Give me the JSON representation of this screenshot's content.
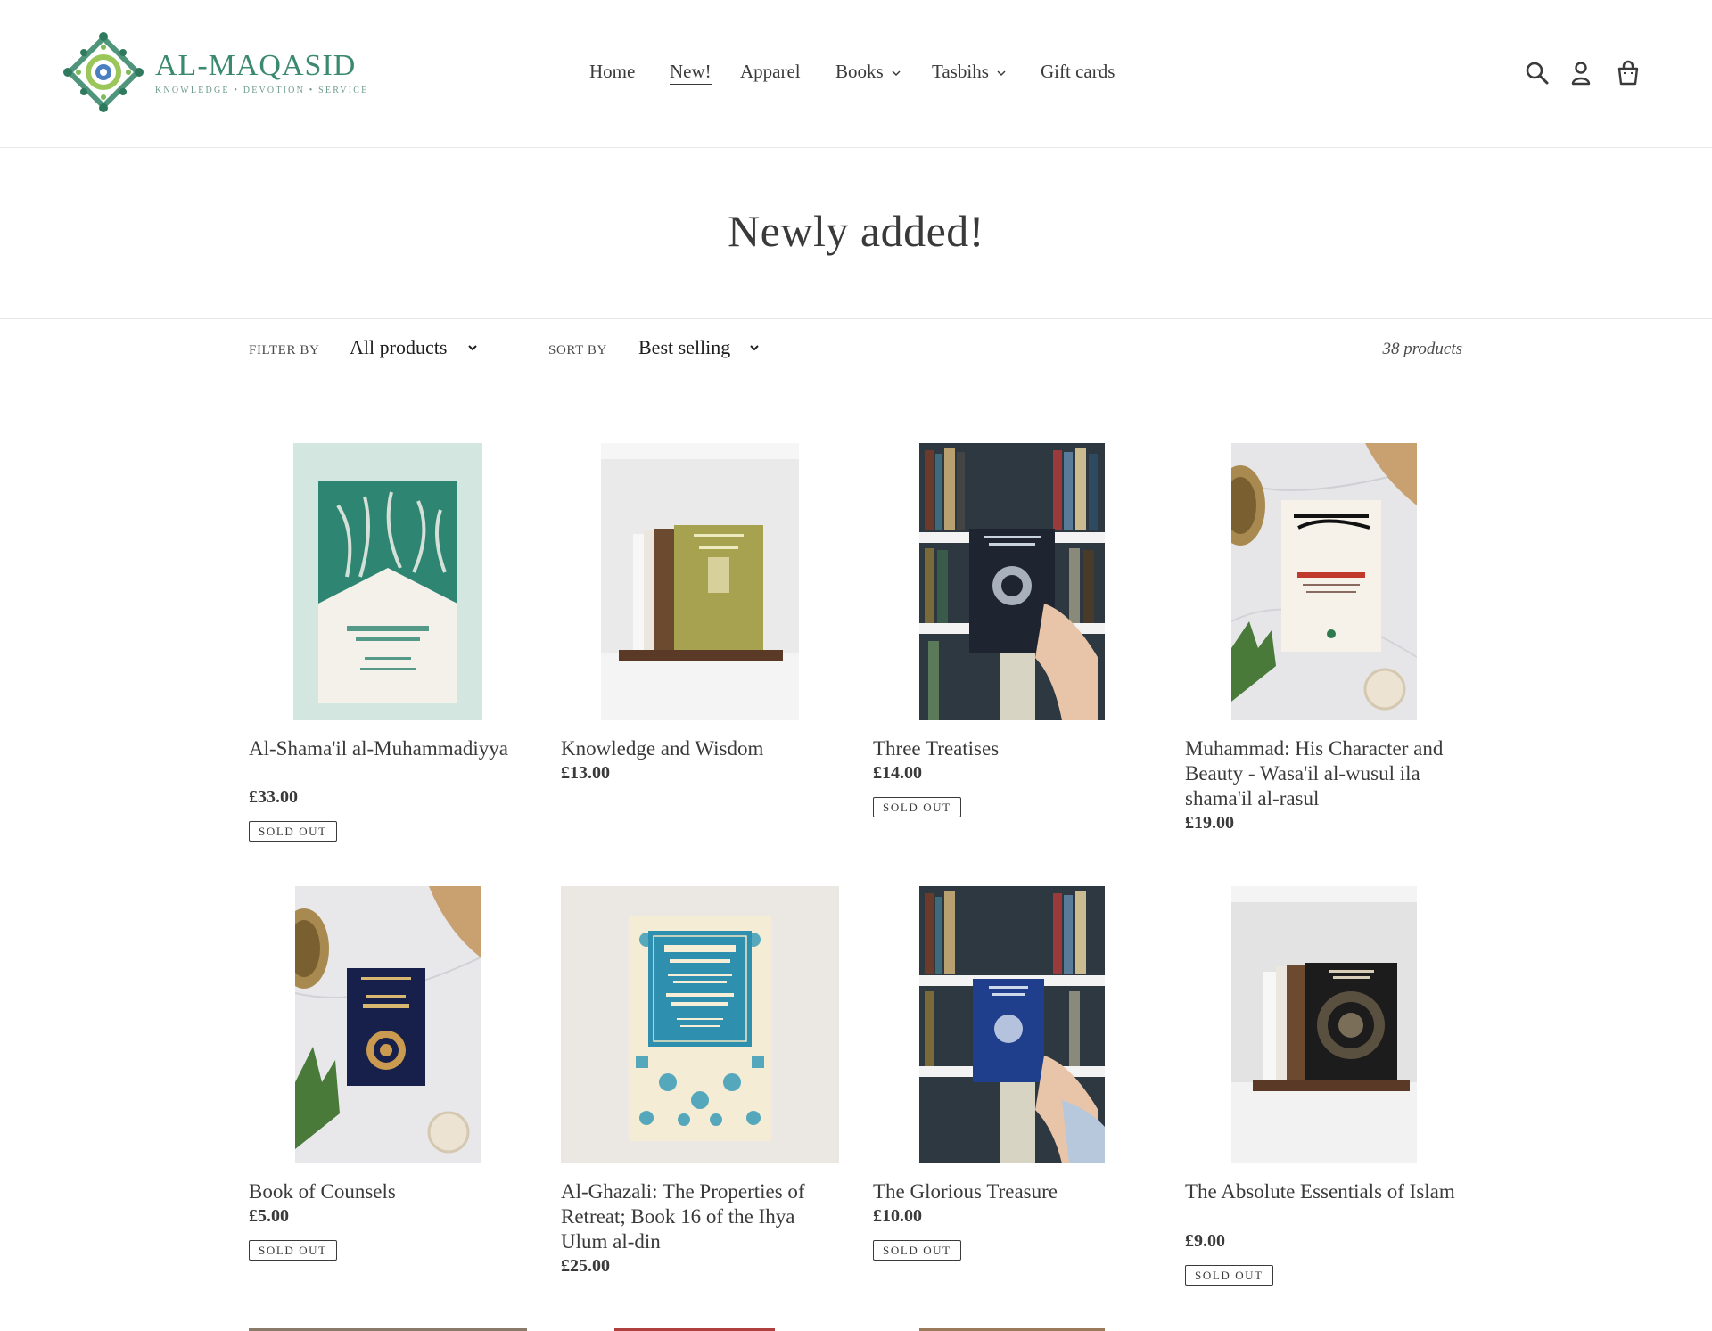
{
  "header": {
    "logo_name": "AL-MAQASID",
    "logo_tagline": "KNOWLEDGE • DEVOTION • SERVICE",
    "nav": [
      {
        "label": "Home",
        "dropdown": false,
        "active": false
      },
      {
        "label": "New!",
        "dropdown": false,
        "active": true
      },
      {
        "label": "Apparel",
        "dropdown": false,
        "active": false
      },
      {
        "label": "Books",
        "dropdown": true,
        "active": false
      },
      {
        "label": "Tasbihs",
        "dropdown": true,
        "active": false
      },
      {
        "label": "Gift cards",
        "dropdown": false,
        "active": false
      }
    ],
    "icons": [
      "search-icon",
      "account-icon",
      "cart-icon"
    ]
  },
  "page": {
    "title": "Newly added!"
  },
  "filters": {
    "filter_label": "FILTER BY",
    "filter_value": "All products",
    "sort_label": "SORT BY",
    "sort_value": "Best selling",
    "count": "38 products"
  },
  "products": [
    {
      "title": "Al-Shama'il al-Muhammadiyya",
      "price": "£33.00",
      "badge": "SOLD OUT"
    },
    {
      "title": "Knowledge and Wisdom",
      "price": "£13.00",
      "badge": ""
    },
    {
      "title": "Three Treatises",
      "price": "£14.00",
      "badge": "SOLD OUT"
    },
    {
      "title": "Muhammad: His Character and Beauty - Wasa'il al-wusul ila shama'il al-rasul",
      "price": "£19.00",
      "badge": ""
    },
    {
      "title": "Book of Counsels",
      "price": "£5.00",
      "badge": "SOLD OUT"
    },
    {
      "title": "Al-Ghazali: The Properties of Retreat; Book 16 of the Ihya Ulum al-din",
      "price": "£25.00",
      "badge": ""
    },
    {
      "title": "The Glorious Treasure",
      "price": "£10.00",
      "badge": "SOLD OUT"
    },
    {
      "title": "The Absolute Essentials of Islam",
      "price": "£9.00",
      "badge": "SOLD OUT"
    }
  ],
  "colors": {
    "brand_green": "#3c8a6e",
    "text": "#3a3a3a",
    "border": "#e8e8e8"
  }
}
